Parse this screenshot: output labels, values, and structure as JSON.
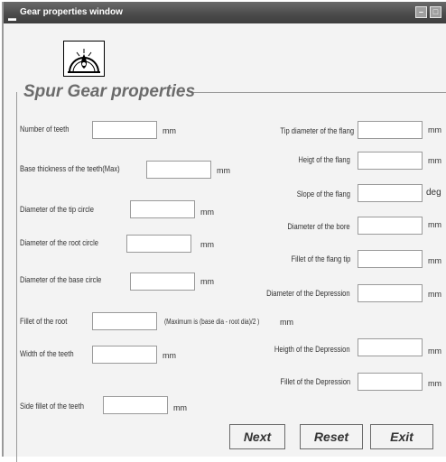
{
  "window": {
    "title": "Gear properties window",
    "title_icon": "window-menu-icon"
  },
  "group_title": "Spur Gear properties",
  "left_fields": [
    {
      "label": "Number of teeth",
      "unit": "mm",
      "value": ""
    },
    {
      "label": "Base thickness of the teeth(Max)",
      "unit": "mm",
      "value": ""
    },
    {
      "label": "Diameter of the tip circle",
      "unit": "mm",
      "value": ""
    },
    {
      "label": "Diameter of the root circle",
      "unit": "mm",
      "value": ""
    },
    {
      "label": "Diameter of the base circle",
      "unit": "mm",
      "value": ""
    },
    {
      "label": "Fillet of the root",
      "note": "(Maximum is (base dia - root dia)/2 )",
      "unit": "mm",
      "value": ""
    },
    {
      "label": "Width of the teeth",
      "unit": "mm",
      "value": ""
    },
    {
      "label": "Side fillet of the teeth",
      "unit": "mm",
      "value": ""
    }
  ],
  "right_fields": [
    {
      "label": "Tip diameter of the flang",
      "unit": "mm",
      "value": ""
    },
    {
      "label": "Heigt of the flang",
      "unit": "mm",
      "value": ""
    },
    {
      "label": "Slope of the flang",
      "unit": "deg",
      "value": ""
    },
    {
      "label": "Diameter of the bore",
      "unit": "mm",
      "value": ""
    },
    {
      "label": "Fillet of the flang tip",
      "unit": "mm",
      "value": ""
    },
    {
      "label": "Diameter of the Depression",
      "unit": "mm",
      "value": ""
    },
    {
      "label": "Heigth of the Depression",
      "unit": "mm",
      "value": ""
    },
    {
      "label": "Fillet of the Depression",
      "unit": "mm",
      "value": ""
    }
  ],
  "buttons": {
    "next": "Next",
    "reset": "Reset",
    "exit": "Exit"
  },
  "icons": {
    "logo": "gear-logo-icon",
    "minimize": "minimize-icon",
    "maximize": "maximize-icon"
  }
}
